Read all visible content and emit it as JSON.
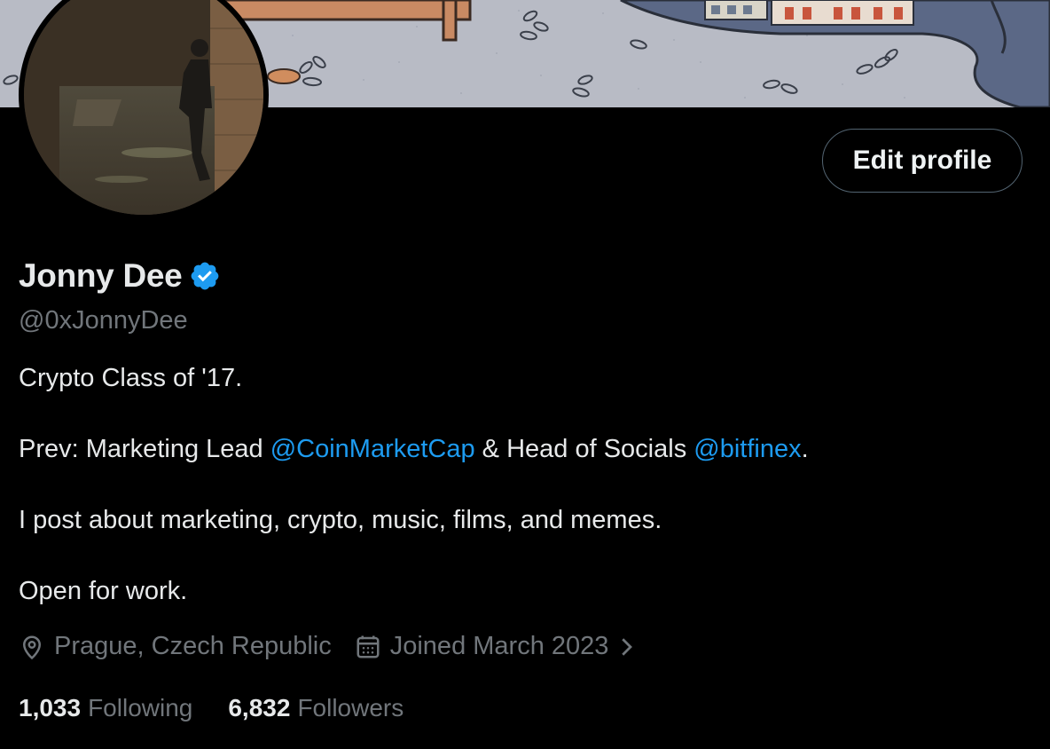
{
  "profile": {
    "name": "Jonny Dee",
    "handle": "@0xJonnyDee",
    "verified_icon": "verified-badge-icon",
    "edit_profile_label": "Edit profile"
  },
  "bio": {
    "line1": "Crypto Class of '17.",
    "line2_prefix": "Prev: Marketing Lead ",
    "line2_mention1": "@CoinMarketCap",
    "line2_mid": " & Head of Socials ",
    "line2_mention2": "@bitfinex",
    "line2_suffix": ".",
    "line3": "I post about marketing, crypto, music, films, and memes.",
    "line4": "Open for work."
  },
  "meta": {
    "location": "Prague, Czech Republic",
    "location_icon": "location-pin-icon",
    "joined": "Joined March 2023",
    "joined_icon": "calendar-icon",
    "chevron_icon": "chevron-right-icon"
  },
  "stats": {
    "following_count": "1,033",
    "following_label": "Following",
    "followers_count": "6,832",
    "followers_label": "Followers"
  },
  "colors": {
    "background": "#000000",
    "text_primary": "#e7e9ea",
    "text_secondary": "#71767b",
    "accent": "#1d9bf0",
    "button_border": "#536471"
  }
}
